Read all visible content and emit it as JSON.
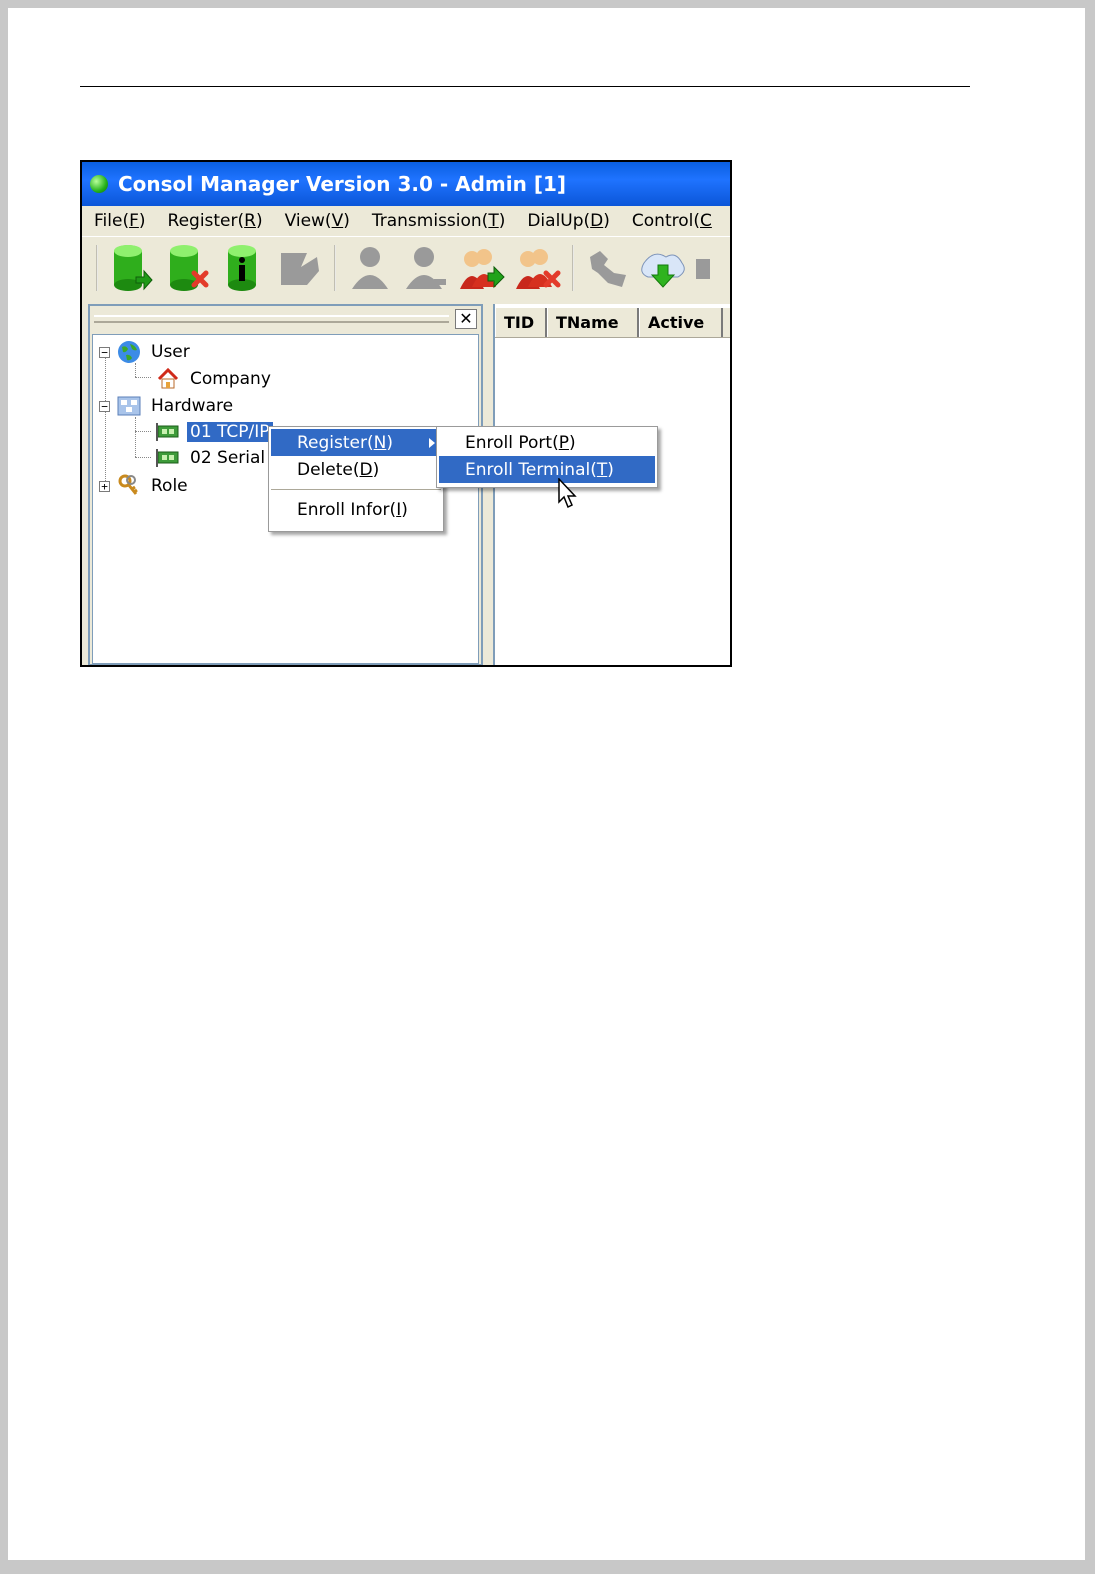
{
  "window": {
    "title": "Consol Manager Version 3.0 - Admin [1]"
  },
  "menubar": [
    {
      "pre": "File(",
      "key": "F",
      "post": ")"
    },
    {
      "pre": "Register(",
      "key": "R",
      "post": ")"
    },
    {
      "pre": "View(",
      "key": "V",
      "post": ")"
    },
    {
      "pre": "Transmission(",
      "key": "T",
      "post": ")"
    },
    {
      "pre": "DialUp(",
      "key": "D",
      "post": ")"
    },
    {
      "pre": "Control(",
      "key": "C",
      "post": ""
    }
  ],
  "toolbar": {
    "icons": [
      "db-add-icon",
      "db-delete-icon",
      "db-info-icon",
      "disabled-tool-icon",
      "user-disabled-icon",
      "user-edit-disabled-icon",
      "users-add-icon",
      "users-delete-icon",
      "transfer-disabled-icon",
      "download-icon",
      "cut-off-icon"
    ]
  },
  "tree": {
    "user": "User",
    "company": "Company",
    "hardware": "Hardware",
    "tcp": "01 TCP/IP",
    "serial": "02 Serial",
    "role": "Role"
  },
  "grid": {
    "columns": [
      "TID",
      "TName",
      "Active"
    ]
  },
  "context_menu": {
    "register": {
      "pre": "Register(",
      "key": "N",
      "post": ")"
    },
    "delete": {
      "pre": "Delete(",
      "key": "D",
      "post": ")"
    },
    "enroll_infor": {
      "pre": "Enroll Infor(",
      "key": "I",
      "post": ")"
    }
  },
  "submenu": {
    "enroll_port": {
      "pre": "Enroll Port(",
      "key": "P",
      "post": ")"
    },
    "enroll_terminal": {
      "pre": "Enroll Terminal(",
      "key": "T",
      "post": ")"
    }
  },
  "colors": {
    "titlebar": "#0a5fe0",
    "selection": "#316ac5",
    "chrome": "#ece9d8"
  }
}
